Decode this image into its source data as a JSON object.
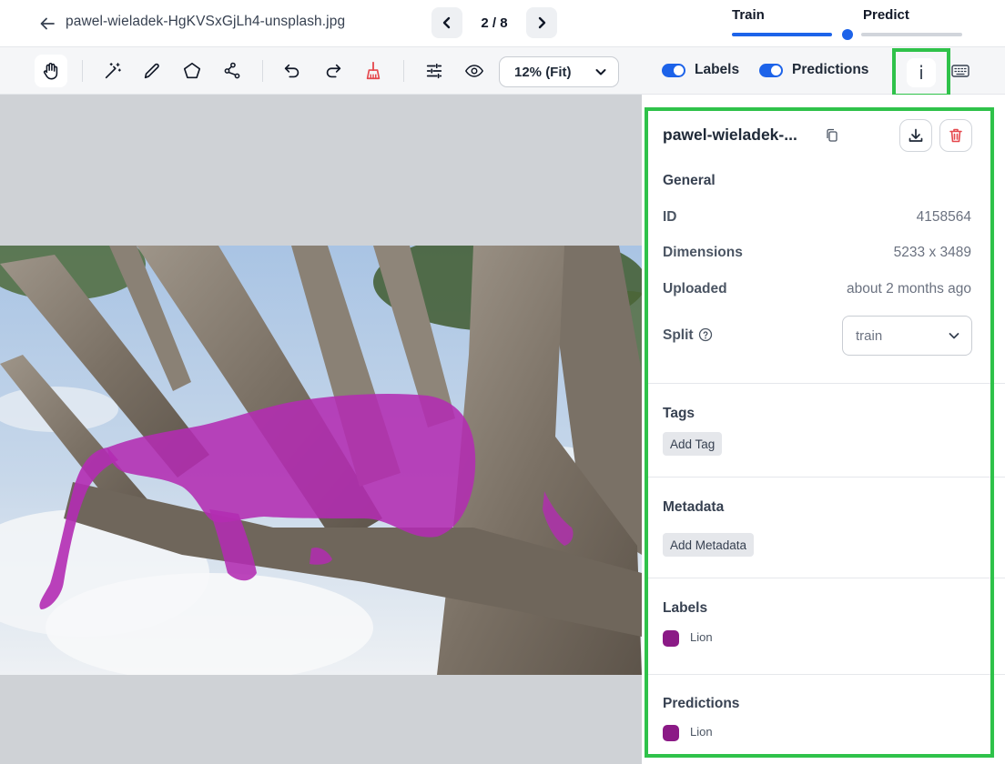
{
  "header": {
    "file_name": "pawel-wieladek-HgKVSxGjLh4-unsplash.jpg",
    "pager": "2 / 8",
    "stages": {
      "train": "Train",
      "predict": "Predict"
    }
  },
  "toolbar": {
    "zoom": "12% (Fit)",
    "labels_toggle": "Labels",
    "predictions_toggle": "Predictions",
    "info_glyph": "i"
  },
  "panel": {
    "title": "pawel-wieladek-...",
    "general": {
      "heading": "General",
      "id_label": "ID",
      "id_value": "4158564",
      "dimensions_label": "Dimensions",
      "dimensions_value": "5233 x 3489",
      "uploaded_label": "Uploaded",
      "uploaded_value": "about 2 months ago",
      "split_label": "Split",
      "split_value": "train"
    },
    "tags": {
      "heading": "Tags",
      "add": "Add Tag"
    },
    "metadata": {
      "heading": "Metadata",
      "add": "Add Metadata"
    },
    "labels": {
      "heading": "Labels",
      "items": [
        {
          "name": "Lion",
          "color": "#8b1a86"
        }
      ]
    },
    "predictions": {
      "heading": "Predictions",
      "items": [
        {
          "name": "Lion",
          "color": "#8b1a86"
        }
      ]
    }
  },
  "colors": {
    "accent": "#1d63e9",
    "highlight": "#2fc24a",
    "danger": "#e5484d",
    "mask": "#b32cb2"
  }
}
